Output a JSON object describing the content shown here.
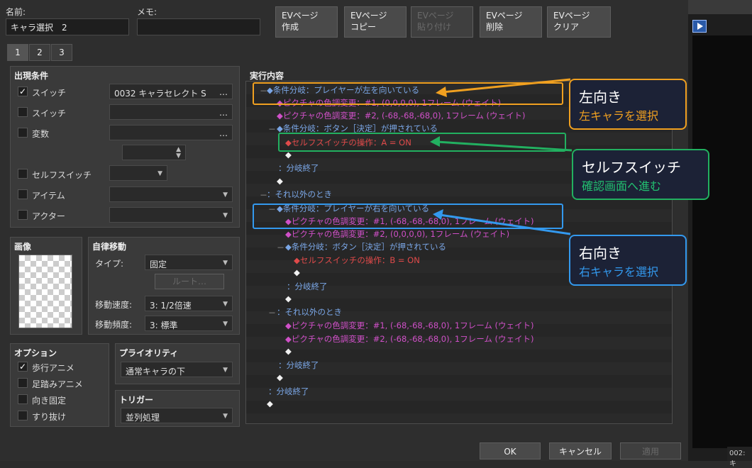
{
  "header": {
    "name_label": "名前:",
    "name_value": "キャラ選択　2",
    "memo_label": "メモ:",
    "memo_value": ""
  },
  "toolbar": [
    {
      "line1": "EVページ",
      "line2": "作成",
      "enabled": true
    },
    {
      "line1": "EVページ",
      "line2": "コピー",
      "enabled": true
    },
    {
      "line1": "EVページ",
      "line2": "貼り付け",
      "enabled": false
    },
    {
      "line1": "EVページ",
      "line2": "削除",
      "enabled": true
    },
    {
      "line1": "EVページ",
      "line2": "クリア",
      "enabled": true
    }
  ],
  "tabs": [
    "1",
    "2",
    "3"
  ],
  "conditions": {
    "title": "出現条件",
    "switch1_label": "スイッチ",
    "switch1_checked": true,
    "switch1_value": "0032 キャラセレクト S",
    "switch1_dots": "…",
    "switch2_label": "スイッチ",
    "switch2_dots": "…",
    "variable_label": "変数",
    "variable_dots": "…",
    "selfswitch_label": "セルフスイッチ",
    "item_label": "アイテム",
    "actor_label": "アクター"
  },
  "image": {
    "title": "画像"
  },
  "autonomous": {
    "title": "自律移動",
    "type_label": "タイプ:",
    "type_value": "固定",
    "route_button": "ルート…",
    "speed_label": "移動速度:",
    "speed_value": "3: 1/2倍速",
    "freq_label": "移動頻度:",
    "freq_value": "3: 標準"
  },
  "options": {
    "title": "オプション",
    "walking_anime": "歩行アニメ",
    "walking_checked": true,
    "stepping_anime": "足踏みアニメ",
    "direction_fix": "向き固定",
    "through": "すり抜け"
  },
  "priority": {
    "title": "プライオリティ",
    "value": "通常キャラの下"
  },
  "trigger": {
    "title": "トリガー",
    "value": "並列処理"
  },
  "contents": {
    "title": "実行内容",
    "lines": [
      "◆条件分岐：プレイヤーが左を向いている",
      "◆ピクチャの色調変更：#1, (0,0,0,0), 1フレーム (ウェイト)",
      "◆ピクチャの色調変更：#2, (-68,-68,-68,0), 1フレーム (ウェイト)",
      "◆条件分岐：ボタン［決定］が押されている",
      "◆セルフスイッチの操作：A = ON",
      "◆",
      "：分岐終了",
      "◆",
      "：それ以外のとき",
      "◆条件分岐：プレイヤーが右を向いている",
      "◆ピクチャの色調変更：#1, (-68,-68,-68,0), 1フレーム (ウェイト)",
      "◆ピクチャの色調変更：#2, (0,0,0,0), 1フレーム (ウェイト)",
      "◆条件分岐：ボタン［決定］が押されている",
      "◆セルフスイッチの操作：B = ON",
      "◆",
      "：分岐終了",
      "◆",
      "：それ以外のとき",
      "◆ピクチャの色調変更：#1, (-68,-68,-68,0), 1フレーム (ウェイト)",
      "◆ピクチャの色調変更：#2, (-68,-68,-68,0), 1フレーム (ウェイト)",
      "◆",
      "：分岐終了",
      "◆",
      "：分岐終了",
      "◆"
    ]
  },
  "callouts": {
    "left_title": "左向き",
    "left_sub": "左キャラを選択",
    "self_title": "セルフスイッチ",
    "self_sub": "確認画面へ進む",
    "right_title": "右向き",
    "right_sub": "右キャラを選択"
  },
  "footer": {
    "ok": "OK",
    "cancel": "キャンセル",
    "apply": "適用"
  },
  "status": "002:キ",
  "colors": {
    "orange": "#f0a020",
    "green": "#22b060",
    "blue": "#3399ee"
  }
}
